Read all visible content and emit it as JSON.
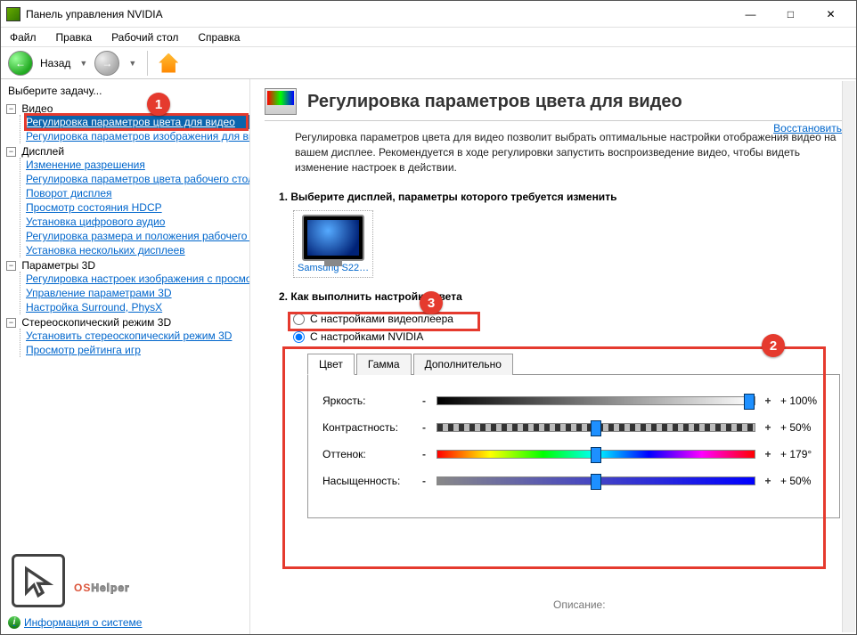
{
  "window": {
    "title": "Панель управления NVIDIA"
  },
  "menu": {
    "file": "Файл",
    "edit": "Правка",
    "desktop": "Рабочий стол",
    "help": "Справка"
  },
  "toolbar": {
    "back": "Назад"
  },
  "sidebar": {
    "header": "Выберите задачу...",
    "video": {
      "label": "Видео",
      "items": [
        "Регулировка параметров цвета для видео",
        "Регулировка параметров изображения для видео"
      ]
    },
    "display": {
      "label": "Дисплей",
      "items": [
        "Изменение разрешения",
        "Регулировка параметров цвета рабочего стола",
        "Поворот дисплея",
        "Просмотр состояния HDCP",
        "Установка цифрового аудио",
        "Регулировка размера и положения рабочего стола",
        "Установка нескольких дисплеев"
      ]
    },
    "params3d": {
      "label": "Параметры 3D",
      "items": [
        "Регулировка настроек изображения с просмотром",
        "Управление параметрами 3D",
        "Настройка Surround, PhysX"
      ]
    },
    "stereo": {
      "label": "Стереоскопический режим 3D",
      "items": [
        "Установить стереоскопический режим 3D",
        "Просмотр рейтинга игр"
      ]
    }
  },
  "page": {
    "title": "Регулировка параметров цвета для видео",
    "restore": "Восстановить",
    "desc": "Регулировка параметров цвета для видео позволит выбрать оптимальные настройки отображения видео на вашем дисплее. Рекомендуется в ходе регулировки запустить воспроизведение видео, чтобы видеть изменение настроек в действии.",
    "sec1": "1. Выберите дисплей, параметры которого требуется изменить",
    "display_name": "Samsung S22…",
    "sec2": "2. Как выполнить настройку цвета",
    "radio_player": "С настройками видеоплеера",
    "radio_nvidia": "С настройками NVIDIA",
    "tabs": {
      "color": "Цвет",
      "gamma": "Гамма",
      "extra": "Дополнительно"
    },
    "sliders": {
      "brightness": {
        "label": "Яркость:",
        "value": "+ 100%"
      },
      "contrast": {
        "label": "Контрастность:",
        "value": "+ 50%"
      },
      "hue": {
        "label": "Оттенок:",
        "value": "+ 179°"
      },
      "saturation": {
        "label": "Насыщенность:",
        "value": "+ 50%"
      }
    },
    "desc_label": "Описание:"
  },
  "footer": {
    "sysinfo": "Информация о системе"
  },
  "watermark": {
    "os": "OS",
    "helper": "Helper"
  },
  "chart_data": {
    "type": "table",
    "title": "Регулировка параметров цвета для видео",
    "series": [
      {
        "name": "Яркость",
        "value": 100,
        "unit": "%",
        "range": [
          0,
          100
        ]
      },
      {
        "name": "Контрастность",
        "value": 50,
        "unit": "%",
        "range": [
          0,
          100
        ]
      },
      {
        "name": "Оттенок",
        "value": 179,
        "unit": "°",
        "range": [
          0,
          359
        ]
      },
      {
        "name": "Насыщенность",
        "value": 50,
        "unit": "%",
        "range": [
          0,
          100
        ]
      }
    ]
  }
}
